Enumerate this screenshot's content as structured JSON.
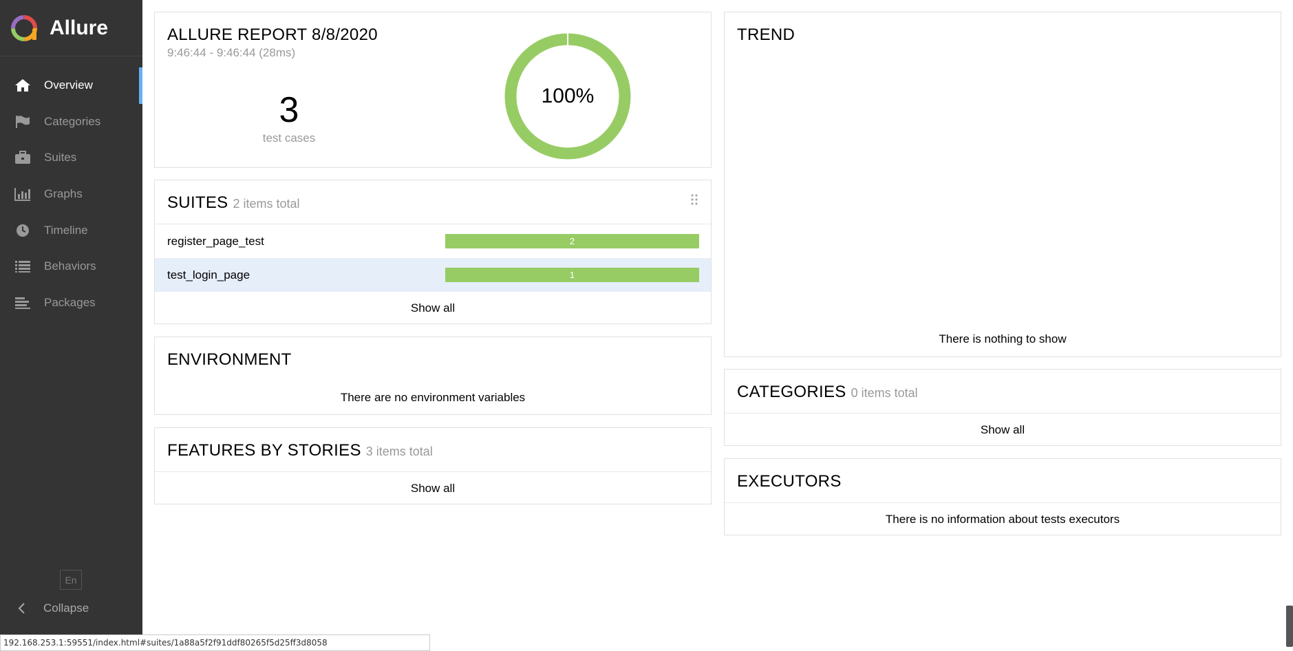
{
  "sidebar": {
    "brand": "Allure",
    "items": [
      {
        "label": "Overview",
        "icon": "home-icon"
      },
      {
        "label": "Categories",
        "icon": "flag-icon"
      },
      {
        "label": "Suites",
        "icon": "briefcase-icon"
      },
      {
        "label": "Graphs",
        "icon": "bar-chart-icon"
      },
      {
        "label": "Timeline",
        "icon": "clock-icon"
      },
      {
        "label": "Behaviors",
        "icon": "list-icon"
      },
      {
        "label": "Packages",
        "icon": "align-left-icon"
      }
    ],
    "active_index": 0,
    "language": "En",
    "collapse_label": "Collapse"
  },
  "summary": {
    "title": "ALLURE REPORT 8/8/2020",
    "time": "9:46:44 - 9:46:44 (28ms)",
    "test_count": "3",
    "test_count_label": "test cases",
    "percent": "100%",
    "passed_fraction": 1.0
  },
  "suites": {
    "title": "SUITES",
    "count_text": "2 items total",
    "rows": [
      {
        "name": "register_page_test",
        "count": "2",
        "selected": false
      },
      {
        "name": "test_login_page",
        "count": "1",
        "selected": true
      }
    ],
    "show_all": "Show all"
  },
  "environment": {
    "title": "ENVIRONMENT",
    "empty_text": "There are no environment variables"
  },
  "features": {
    "title": "FEATURES BY STORIES",
    "count_text": "3 items total",
    "show_all": "Show all"
  },
  "trend": {
    "title": "TREND",
    "empty_text": "There is nothing to show"
  },
  "categories": {
    "title": "CATEGORIES",
    "count_text": "0 items total",
    "show_all": "Show all"
  },
  "executors": {
    "title": "EXECUTORS",
    "empty_text": "There is no information about tests executors"
  },
  "status_bar": {
    "url": "192.168.253.1:59551/index.html#suites/1a88a5f2f91ddf80265f5d25ff3d8058"
  },
  "colors": {
    "sidebar_bg": "#343434",
    "active_accent": "#6ab0f3",
    "passed": "#97cc64",
    "selected_row": "#e6eefa"
  }
}
